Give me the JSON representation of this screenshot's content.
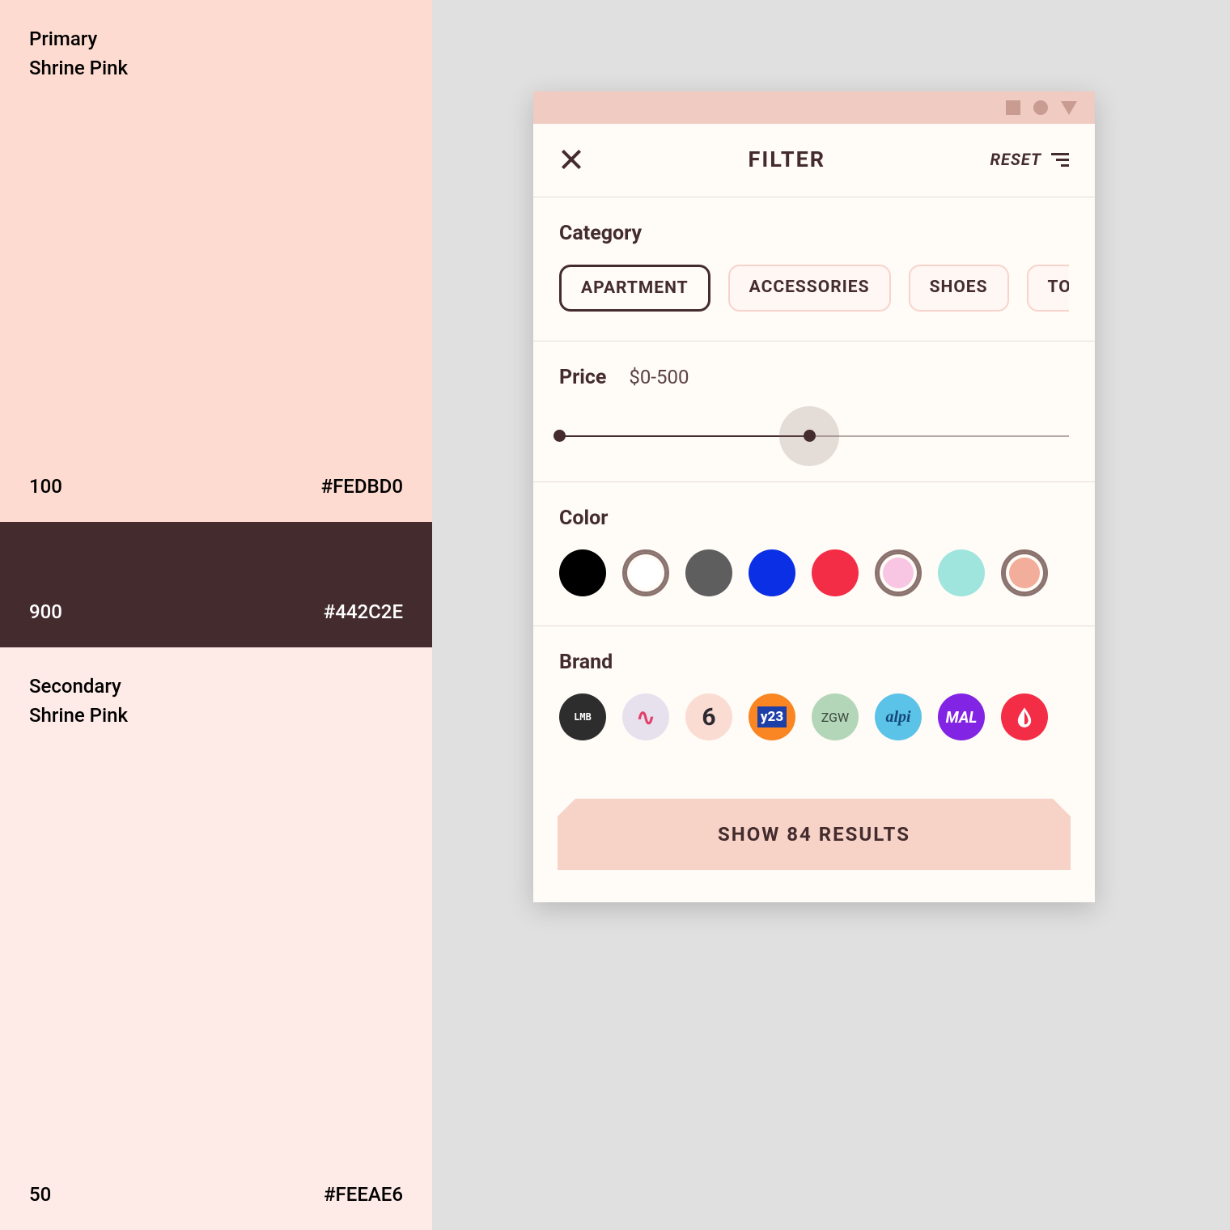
{
  "palette": {
    "primary": {
      "label": "Primary",
      "name": "Shrine Pink",
      "shade": "100",
      "hex": "#FEDBD0"
    },
    "accent": {
      "shade": "900",
      "hex": "#442C2E"
    },
    "secondary": {
      "label": "Secondary",
      "name": "Shrine Pink",
      "shade": "50",
      "hex": "#FEEAE6"
    }
  },
  "filter": {
    "title": "FILTER",
    "reset": "RESET",
    "category": {
      "title": "Category",
      "items": [
        "APARTMENT",
        "ACCESSORIES",
        "SHOES",
        "TO"
      ],
      "selected": 0
    },
    "price": {
      "title": "Price",
      "range_label": "$0-500",
      "min_pct": 0,
      "max_pct": 49
    },
    "color": {
      "title": "Color",
      "items": [
        {
          "hex": "#000000",
          "ringed": false
        },
        {
          "hex": "#FFFFFF",
          "ringed": true
        },
        {
          "hex": "#5E5E5E",
          "ringed": false
        },
        {
          "hex": "#0A2FE5",
          "ringed": false
        },
        {
          "hex": "#F42D46",
          "ringed": false
        },
        {
          "hex": "#F8C5E3",
          "ringed": true
        },
        {
          "hex": "#9FE5DE",
          "ringed": false
        },
        {
          "hex": "#F2AE9B",
          "ringed": true
        }
      ]
    },
    "brand": {
      "title": "Brand",
      "items": [
        {
          "bg": "#2D2D2D",
          "fg": "#FFFFFF",
          "label": "LMB",
          "style": "mono"
        },
        {
          "bg": "#E7E1EE",
          "fg": "#E2416B",
          "label": "∿",
          "style": "squiggle"
        },
        {
          "bg": "#FADCD2",
          "fg": "#2E2A33",
          "label": "6",
          "style": "big"
        },
        {
          "bg": "#F98622",
          "fg": "#FFFFFF",
          "label": "y23",
          "style": "box"
        },
        {
          "bg": "#B3D6B8",
          "fg": "#3C4A3C",
          "label": "ZGW",
          "style": "thin"
        },
        {
          "bg": "#5BC3E8",
          "fg": "#14487A",
          "label": "alpi",
          "style": "script"
        },
        {
          "bg": "#8224E3",
          "fg": "#FFFFFF",
          "label": "MAL",
          "style": "italic"
        },
        {
          "bg": "#F42D46",
          "fg": "#FFFFFF",
          "label": "◐",
          "style": "drop"
        }
      ]
    },
    "cta": "SHOW 84 RESULTS"
  }
}
